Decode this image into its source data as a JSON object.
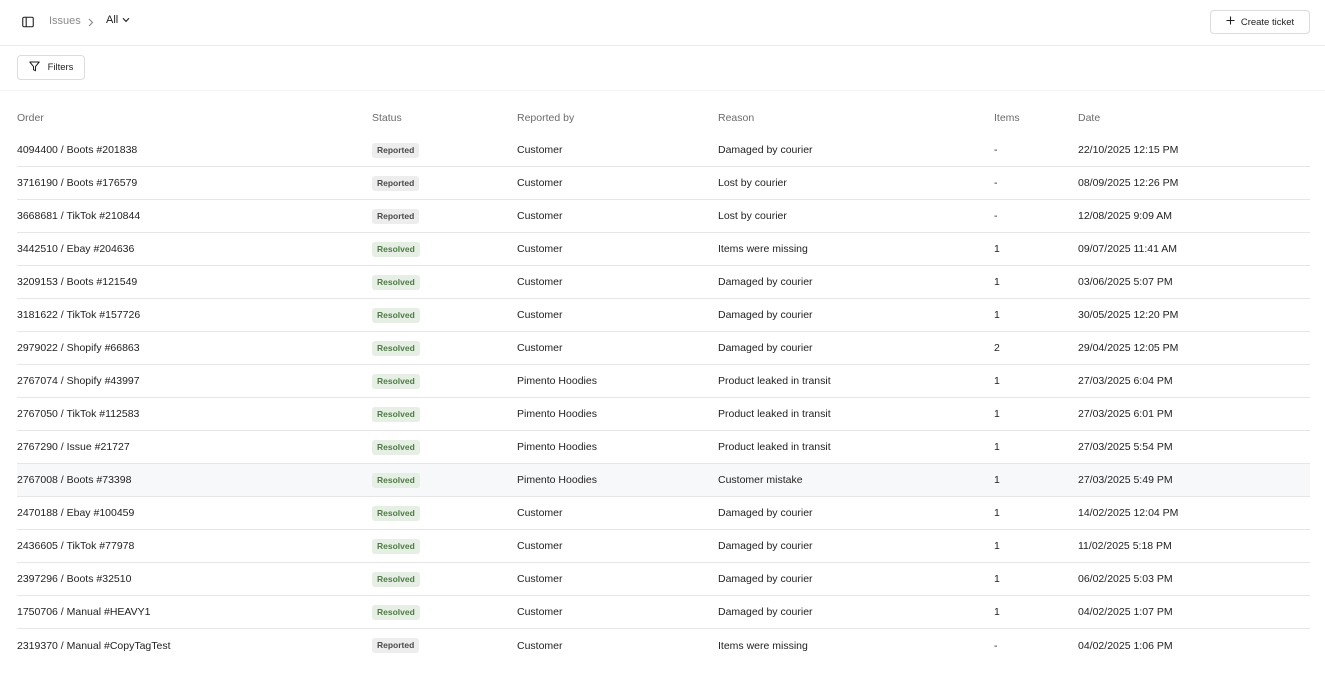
{
  "header": {
    "breadcrumb_parent": "Issues",
    "breadcrumb_current": "All",
    "create_label": "Create ticket"
  },
  "toolbar": {
    "filters_label": "Filters"
  },
  "table": {
    "columns": [
      "Order",
      "Status",
      "Reported by",
      "Reason",
      "Items",
      "Date"
    ],
    "rows": [
      {
        "order": "4094400 / Boots #201838",
        "status": "Reported",
        "reported_by": "Customer",
        "reason": "Damaged by courier",
        "items": "-",
        "date": "22/10/2025 12:15 PM"
      },
      {
        "order": "3716190 / Boots #176579",
        "status": "Reported",
        "reported_by": "Customer",
        "reason": "Lost by courier",
        "items": "-",
        "date": "08/09/2025 12:26 PM"
      },
      {
        "order": "3668681 / TikTok #210844",
        "status": "Reported",
        "reported_by": "Customer",
        "reason": "Lost by courier",
        "items": "-",
        "date": "12/08/2025 9:09 AM"
      },
      {
        "order": "3442510 / Ebay #204636",
        "status": "Resolved",
        "reported_by": "Customer",
        "reason": "Items were missing",
        "items": "1",
        "date": "09/07/2025 11:41 AM"
      },
      {
        "order": "3209153 / Boots #121549",
        "status": "Resolved",
        "reported_by": "Customer",
        "reason": "Damaged by courier",
        "items": "1",
        "date": "03/06/2025 5:07 PM"
      },
      {
        "order": "3181622 / TikTok #157726",
        "status": "Resolved",
        "reported_by": "Customer",
        "reason": "Damaged by courier",
        "items": "1",
        "date": "30/05/2025 12:20 PM"
      },
      {
        "order": "2979022 / Shopify #66863",
        "status": "Resolved",
        "reported_by": "Customer",
        "reason": "Damaged by courier",
        "items": "2",
        "date": "29/04/2025 12:05 PM"
      },
      {
        "order": "2767074 / Shopify #43997",
        "status": "Resolved",
        "reported_by": "Pimento Hoodies",
        "reason": "Product leaked in transit",
        "items": "1",
        "date": "27/03/2025 6:04 PM"
      },
      {
        "order": "2767050 / TikTok #112583",
        "status": "Resolved",
        "reported_by": "Pimento Hoodies",
        "reason": "Product leaked in transit",
        "items": "1",
        "date": "27/03/2025 6:01 PM"
      },
      {
        "order": "2767290 / Issue #21727",
        "status": "Resolved",
        "reported_by": "Pimento Hoodies",
        "reason": "Product leaked in transit",
        "items": "1",
        "date": "27/03/2025 5:54 PM"
      },
      {
        "order": "2767008 / Boots #73398",
        "status": "Resolved",
        "reported_by": "Pimento Hoodies",
        "reason": "Customer mistake",
        "items": "1",
        "date": "27/03/2025 5:49 PM",
        "hovered": true
      },
      {
        "order": "2470188 / Ebay #100459",
        "status": "Resolved",
        "reported_by": "Customer",
        "reason": "Damaged by courier",
        "items": "1",
        "date": "14/02/2025 12:04 PM"
      },
      {
        "order": "2436605 / TikTok #77978",
        "status": "Resolved",
        "reported_by": "Customer",
        "reason": "Damaged by courier",
        "items": "1",
        "date": "11/02/2025 5:18 PM"
      },
      {
        "order": "2397296 / Boots #32510",
        "status": "Resolved",
        "reported_by": "Customer",
        "reason": "Damaged by courier",
        "items": "1",
        "date": "06/02/2025 5:03 PM"
      },
      {
        "order": "1750706 / Manual #HEAVY1",
        "status": "Resolved",
        "reported_by": "Customer",
        "reason": "Damaged by courier",
        "items": "1",
        "date": "04/02/2025 1:07 PM"
      },
      {
        "order": "2319370 / Manual #CopyTagTest",
        "status": "Reported",
        "reported_by": "Customer",
        "reason": "Items were missing",
        "items": "-",
        "date": "04/02/2025 1:06 PM"
      }
    ]
  },
  "colors": {
    "reported_badge_bg": "#ededed",
    "resolved_badge_bg": "#e6efe3",
    "resolved_badge_text": "#4f7a47"
  },
  "icons": {
    "sidebar_toggle": "sidebar-toggle-icon",
    "breadcrumb_separator": "chevron-right-icon",
    "dropdown": "chevron-down-icon",
    "create": "plus-icon",
    "filters": "filter-icon"
  }
}
